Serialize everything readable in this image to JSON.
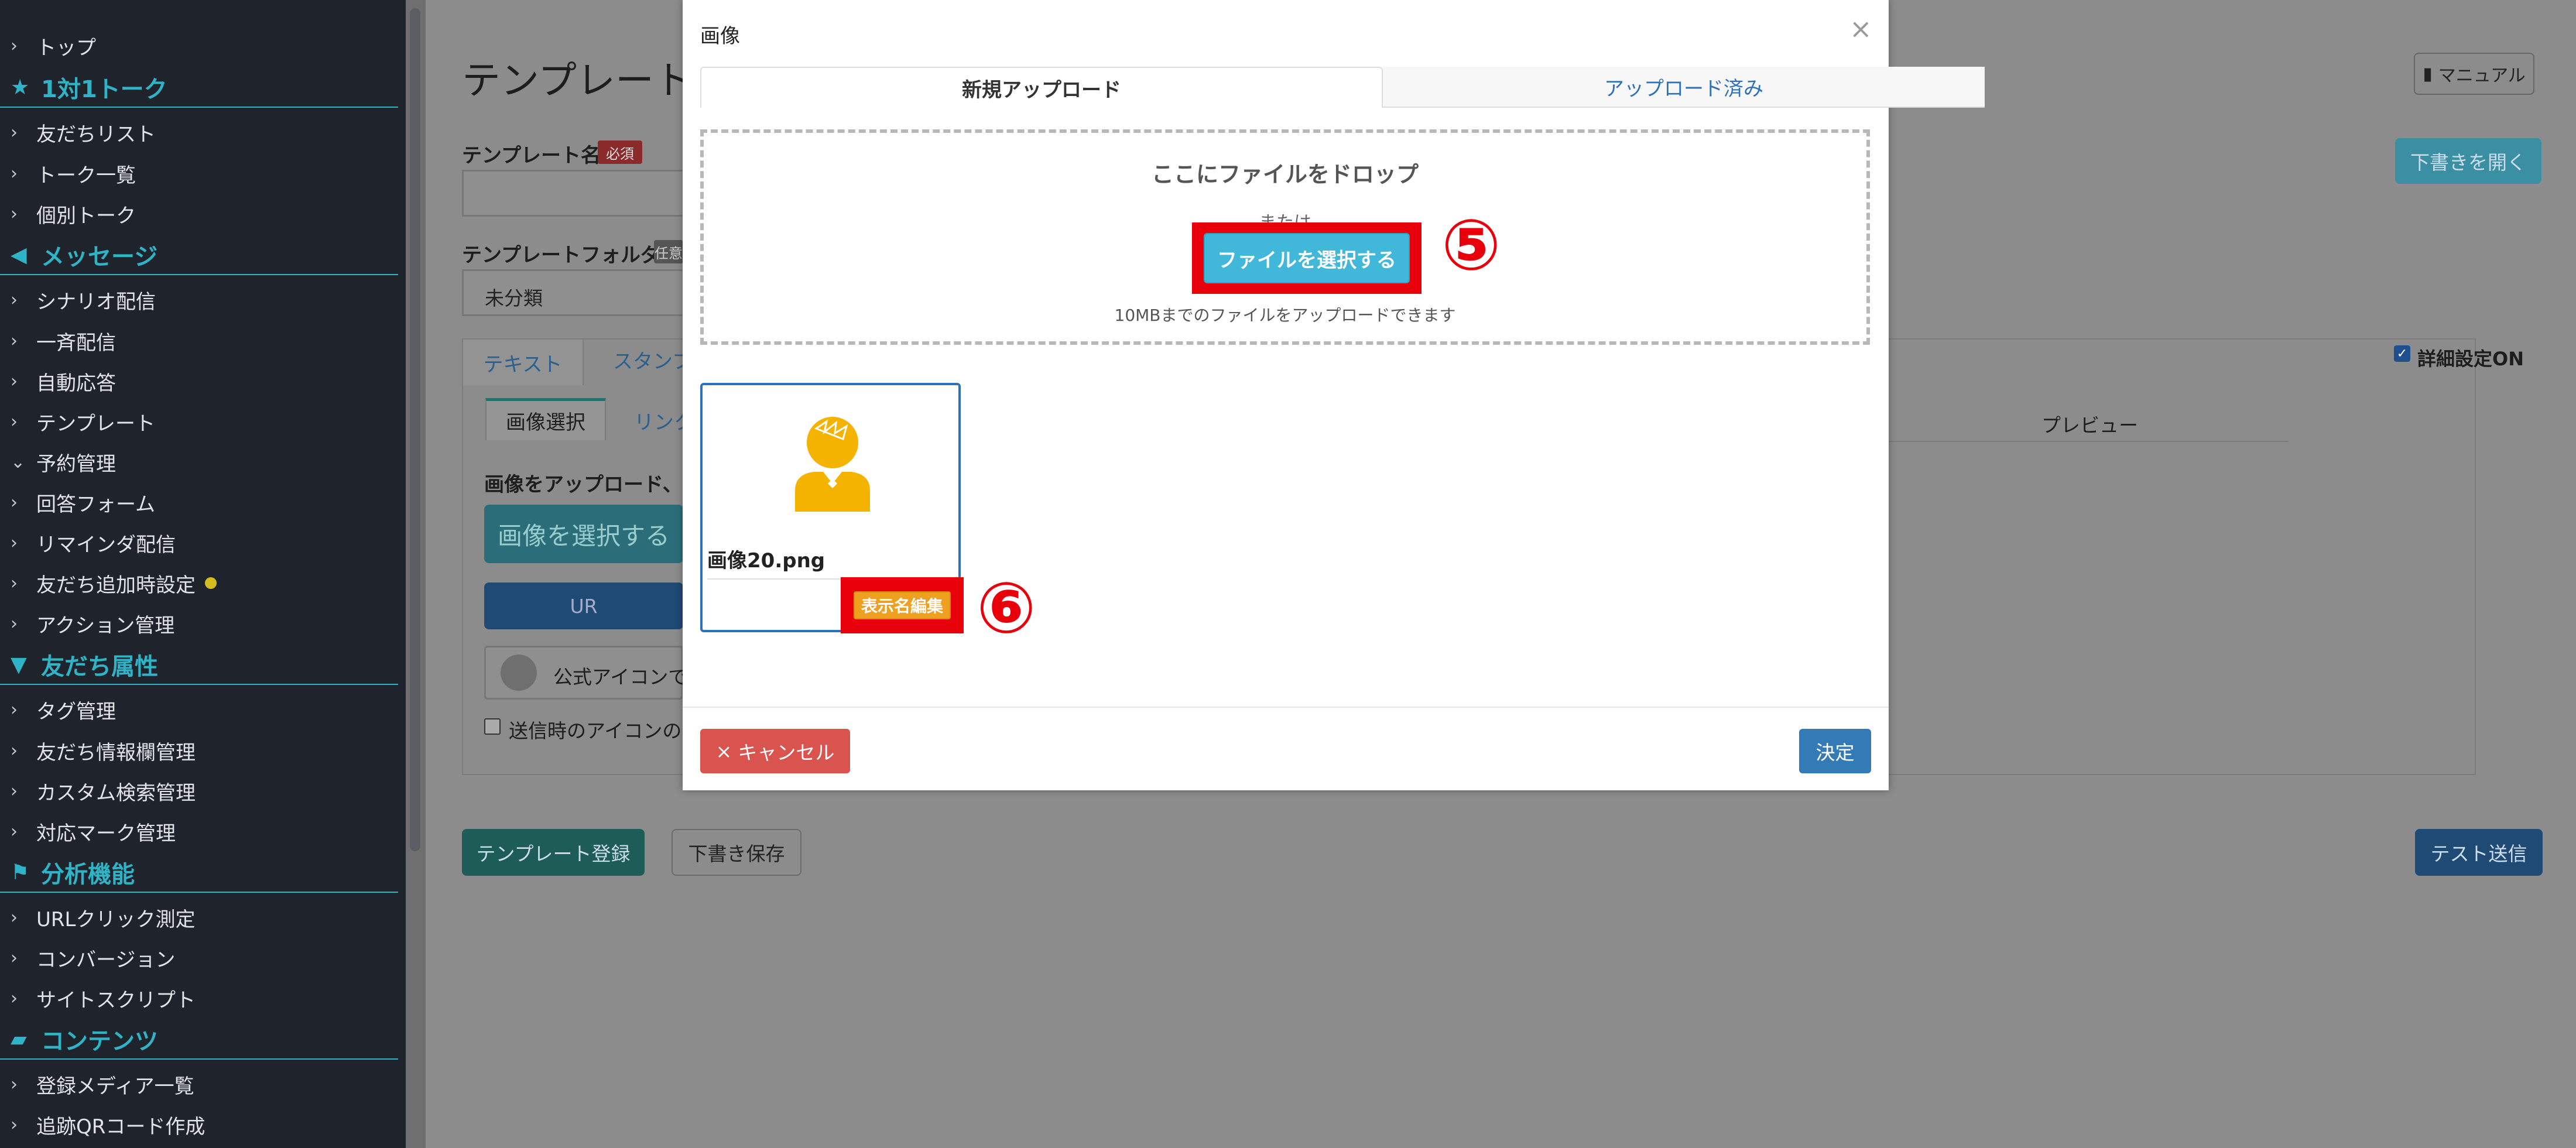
{
  "sidebar": {
    "top": "トップ",
    "section_talk": "1対1トーク",
    "friends_list": "友だちリスト",
    "talk_list": "トーク一覧",
    "individual_talk": "個別トーク",
    "section_message": "メッセージ",
    "scenario": "シナリオ配信",
    "broadcast": "一斉配信",
    "auto_reply": "自動応答",
    "template": "テンプレート",
    "reservation": "予約管理",
    "answer_form": "回答フォーム",
    "reminder": "リマインダ配信",
    "friend_add_setting": "友だち追加時設定",
    "action": "アクション管理",
    "section_attr": "友だち属性",
    "tag": "タグ管理",
    "friend_info": "友だち情報欄管理",
    "custom_search": "カスタム検索管理",
    "mark": "対応マーク管理",
    "section_analysis": "分析機能",
    "url_click": "URLクリック測定",
    "conversion": "コンバージョン",
    "site_script": "サイトスクリプト",
    "section_contents": "コンテンツ",
    "media_list": "登録メディア一覧",
    "qr": "追跡QRコード作成"
  },
  "page": {
    "title": "テンプレート",
    "manual_button": "マニュアル",
    "template_name_label": "テンプレート名",
    "required_badge": "必須",
    "open_draft_button": "下書きを開く",
    "folder_label": "テンプレートフォルダ",
    "folder_badge": "任意",
    "folder_value": "未分類",
    "tab_text": "テキスト",
    "tab_stamp": "スタンプ",
    "detail_setting": "詳細設定ON",
    "subtab_image_select": "画像選択",
    "subtab_link": "リンク",
    "preview_label": "プレビュー",
    "upload_hint": "画像をアップロード、ま",
    "select_image_button": "画像を選択する",
    "url_button": "UR",
    "official_icon_text": "公式アイコンで",
    "send_icon_checkbox": "送信時のアイコンの",
    "register_button": "テンプレート登録",
    "save_draft_button": "下書き保存",
    "test_send_button": "テスト送信"
  },
  "modal": {
    "title": "画像",
    "tab_new_upload": "新規アップロード",
    "tab_uploaded": "アップロード済み",
    "drop_title": "ここにファイルをドロップ",
    "drop_or": "または",
    "select_file_button": "ファイルを選択する",
    "drop_note": "10MBまでのファイルをアップロードできます",
    "file_name": "画像20.png",
    "edit_name_button": "表示名編集",
    "cancel_button": "キャンセル",
    "ok_button": "決定",
    "callout_5": "⑤",
    "callout_6": "⑥"
  },
  "colors": {
    "sidebar_bg": "#1f232b",
    "accent": "#2fb3c7",
    "callout": "#e8000b",
    "primary": "#337ab7",
    "danger": "#d9534f",
    "info": "#41b8d9"
  }
}
